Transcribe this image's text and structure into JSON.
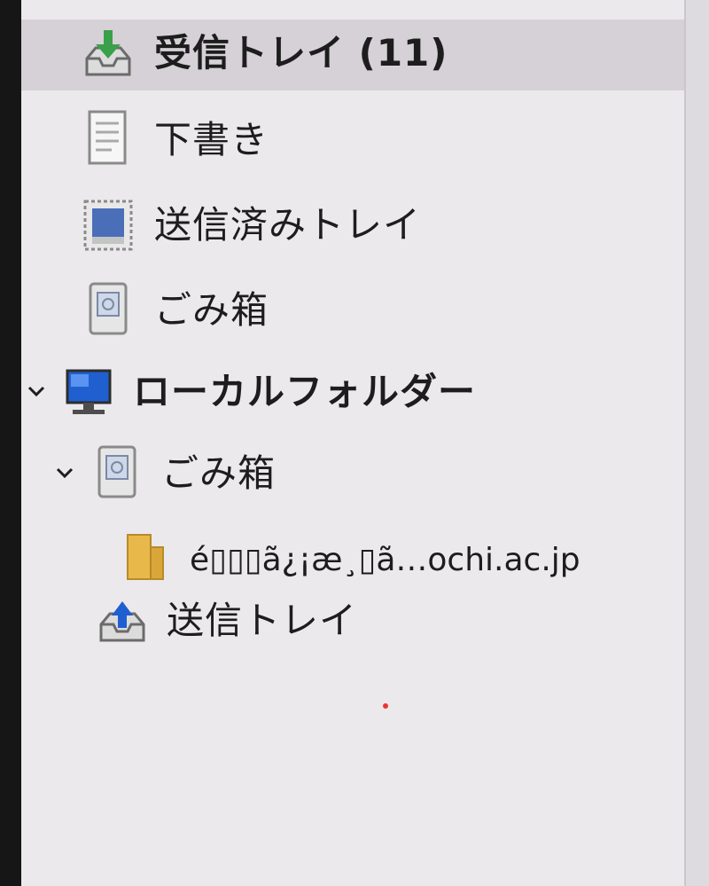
{
  "folders": {
    "inbox": {
      "label": "受信トレイ (11)",
      "icon": "inbox-download-icon"
    },
    "drafts": {
      "label": "下書き",
      "icon": "draft-document-icon"
    },
    "sent": {
      "label": "送信済みトレイ",
      "icon": "sent-folder-icon"
    },
    "trash": {
      "label": "ごみ箱",
      "icon": "trash-icon"
    },
    "local_folders": {
      "label": "ローカルフォルダー",
      "icon": "computer-monitor-icon"
    },
    "local_trash": {
      "label": "ごみ箱",
      "icon": "trash-icon"
    },
    "garbled_folder": {
      "label": "é\u0000\u0000\u0000ã¿¡æ¸\u0000ã…ochi.ac.jp",
      "display": "é▯▯▯ã¿¡æ¸▯ã…ochi.ac.jp",
      "icon": "folder-icon"
    },
    "outbox": {
      "label": "送信トレイ",
      "icon": "outbox-upload-icon"
    }
  },
  "colors": {
    "pane_background": "#ece9ec",
    "selected_row": "#d5d1d6",
    "text": "#1d1d1d",
    "inbox_arrow": "#3aa04a",
    "sent_blue": "#4a6fb8",
    "monitor_blue": "#1f5fd0",
    "folder_yellow": "#e8b84a"
  }
}
